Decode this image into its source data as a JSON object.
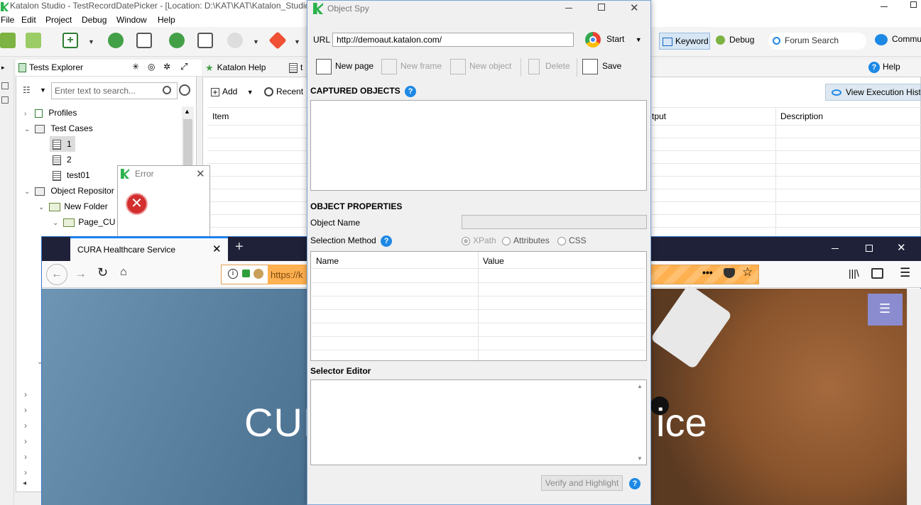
{
  "katalon": {
    "title": "Katalon Studio - TestRecordDatePicker - [Location: D:\\KAT\\KAT\\Katalon_Studio_",
    "menu": [
      "File",
      "Edit",
      "Project",
      "Debug",
      "Window",
      "Help"
    ],
    "toolbar_right": {
      "keyword": "Keyword",
      "debug": "Debug",
      "forum_search": "Forum Search",
      "community": "Commu"
    },
    "explorer": {
      "tab": "Tests Explorer",
      "search_placeholder": "Enter text to search...",
      "tree": [
        {
          "label": "Profiles"
        },
        {
          "label": "Test Cases"
        },
        {
          "label": "1"
        },
        {
          "label": "2"
        },
        {
          "label": "test01"
        },
        {
          "label": "Object Repositor"
        },
        {
          "label": "New Folder"
        },
        {
          "label": "Page_CU"
        }
      ]
    },
    "editor": {
      "tabs": [
        "Katalon Help",
        "t"
      ],
      "add_label": "Add",
      "recent_label": "Recent",
      "help_label": "Help",
      "view_exec": "View Execution Histo",
      "columns": {
        "item": "Item",
        "output": "tput",
        "description": "Description"
      }
    },
    "error_dialog": {
      "title": "Error"
    }
  },
  "firefox": {
    "tab_title": "CURA Healthcare Service",
    "url_partial": "https://k",
    "hero_left": "CUR",
    "hero_right": "ice"
  },
  "object_spy": {
    "title": "Object Spy",
    "url_label": "URL",
    "url_value": "http://demoaut.katalon.com/",
    "start_label": "Start",
    "actions": {
      "new_page": "New page",
      "new_frame": "New frame",
      "new_object": "New object",
      "delete": "Delete",
      "save": "Save"
    },
    "captured_objects": "CAPTURED OBJECTS",
    "object_properties": "OBJECT PROPERTIES",
    "object_name_label": "Object Name",
    "object_name_value": "",
    "selection_method_label": "Selection Method",
    "selection_options": [
      "XPath",
      "Attributes",
      "CSS"
    ],
    "selected_method": "XPath",
    "table_columns": {
      "name": "Name",
      "value": "Value"
    },
    "selector_editor": "Selector Editor",
    "verify_button": "Verify and Highlight"
  }
}
